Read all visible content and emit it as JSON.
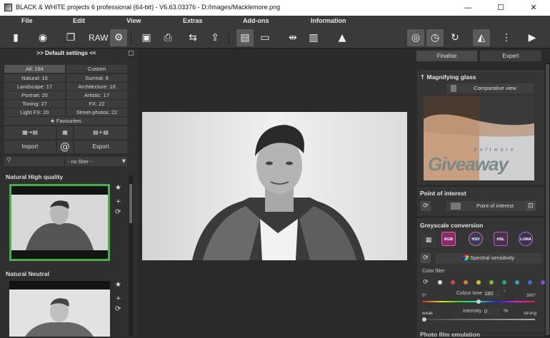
{
  "window": {
    "title": "BLACK & WHITE projects 6 professional (64-bit) - V6.63.03376 - D:/Images/Macklemore.png",
    "minimize": "—",
    "maximize": "☐",
    "close": "✕"
  },
  "menu": [
    "File",
    "Edit",
    "View",
    "Extras",
    "Add-ons",
    "Information"
  ],
  "toolbar": {
    "raw_label": "RAW"
  },
  "left": {
    "title": ">> Default settings <<",
    "categories": [
      [
        "All: 184",
        "Custom"
      ],
      [
        "Natural: 15",
        "Surreal: 8"
      ],
      [
        "Landscape: 17",
        "Architecture: 16"
      ],
      [
        "Portrait: 20",
        "Artistic: 17"
      ],
      [
        "Toning: 27",
        "FX: 22"
      ],
      [
        "Light FX: 20",
        "Street-photos: 22"
      ]
    ],
    "favourites": "Favourites",
    "import": "Import",
    "export": "Export",
    "filter_value": "- no filter -",
    "presets": [
      "Natural High quality",
      "Natural Neutral"
    ]
  },
  "right": {
    "tabs": [
      "Finalise",
      "Expert"
    ],
    "magnifier": {
      "title": "Magnifying glass",
      "comparative": "Comparative view",
      "watermark_small": "Software",
      "watermark": "Giveaway"
    },
    "poi": {
      "title": "Point of interest",
      "button": "Point of interest"
    },
    "greyscale": {
      "title": "Greyscale conversion",
      "modes": [
        "RGB",
        "HSV",
        "HSL",
        "LUMA"
      ],
      "spectral": "Spectral sensitivity",
      "color_filter": "Color filter",
      "dot_colors": [
        "#e0e0e0",
        "#e04040",
        "#e07a20",
        "#d8c020",
        "#70c030",
        "#20b070",
        "#20a8b8",
        "#3070e0",
        "#8050d0"
      ],
      "min_deg": "0°",
      "tone_label": "Colour tone",
      "tone_value": "180",
      "deg_unit": "°",
      "max_deg": "360°",
      "tone_fraction": 0.5,
      "weak": "weak",
      "intensity_label": "Intensity",
      "intensity_value": "0",
      "pct_unit": "%",
      "strong": "strong",
      "intensity_fraction": 0.0
    },
    "next_section": "Photo film emulation"
  }
}
